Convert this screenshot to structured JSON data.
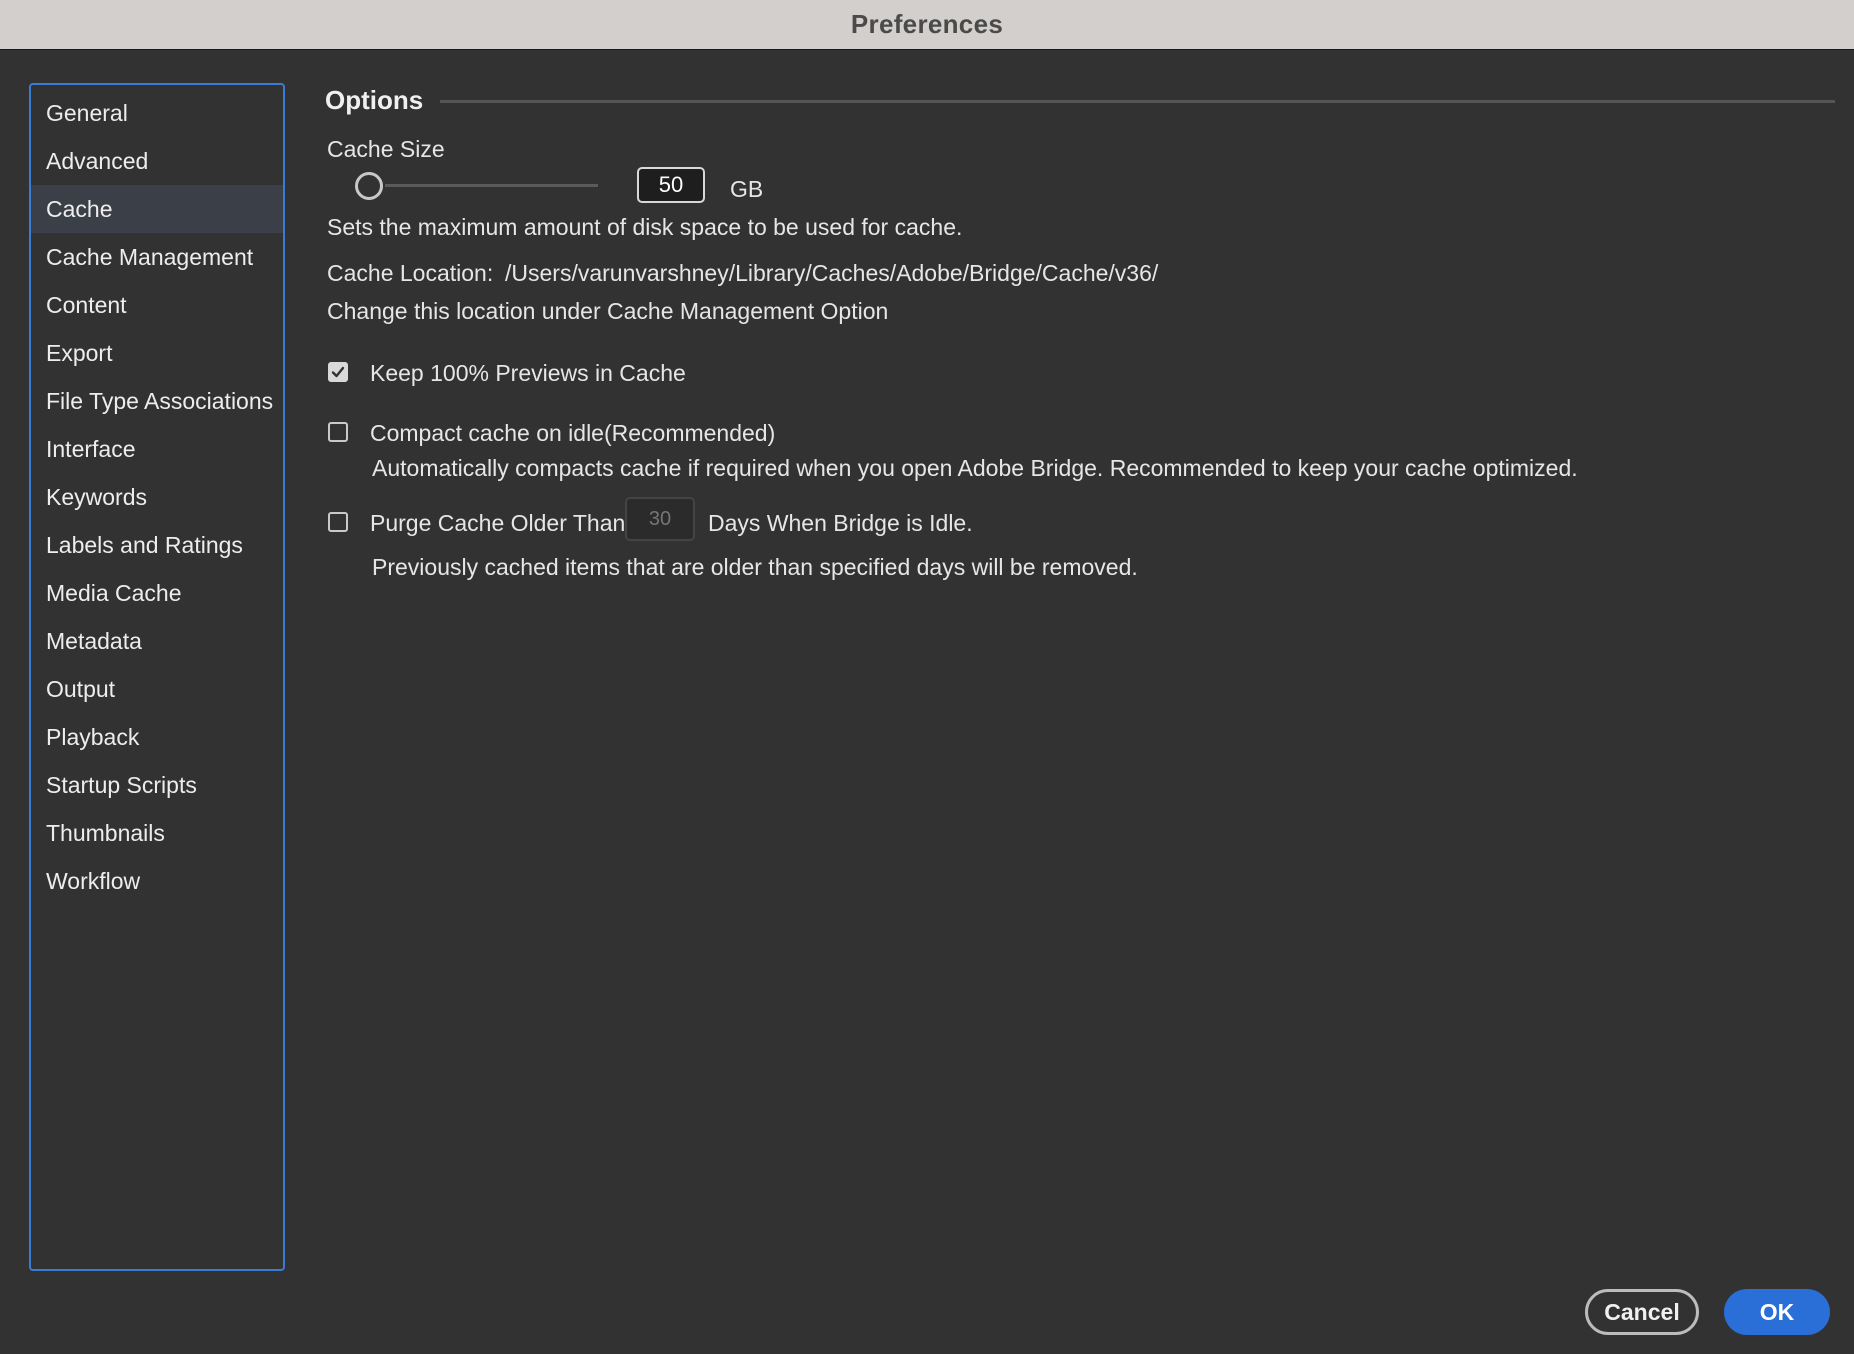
{
  "window": {
    "title": "Preferences"
  },
  "sidebar": {
    "items": [
      {
        "label": "General"
      },
      {
        "label": "Advanced"
      },
      {
        "label": "Cache",
        "selected": true
      },
      {
        "label": "Cache Management"
      },
      {
        "label": "Content"
      },
      {
        "label": "Export"
      },
      {
        "label": "File Type Associations"
      },
      {
        "label": "Interface"
      },
      {
        "label": "Keywords"
      },
      {
        "label": "Labels and Ratings"
      },
      {
        "label": "Media Cache"
      },
      {
        "label": "Metadata"
      },
      {
        "label": "Output"
      },
      {
        "label": "Playback"
      },
      {
        "label": "Startup Scripts"
      },
      {
        "label": "Thumbnails"
      },
      {
        "label": "Workflow"
      }
    ]
  },
  "options": {
    "section_title": "Options",
    "cache_size": {
      "label": "Cache Size",
      "value": "50",
      "unit": "GB",
      "slider_level": 0.0,
      "description": "Sets the maximum amount of disk space to be used for cache."
    },
    "cache_location": {
      "label": "Cache Location:",
      "path": "/Users/varunvarshney/Library/Caches/Adobe/Bridge/Cache/v36/",
      "note": "Change this location under Cache Management Option"
    },
    "keep_previews": {
      "label": "Keep 100% Previews in Cache",
      "checked": true
    },
    "compact_cache": {
      "label": "Compact cache on idle(Recommended)",
      "checked": false,
      "description": "Automatically compacts cache if required when you open Adobe Bridge. Recommended to keep your cache optimized."
    },
    "purge_cache": {
      "label_before": "Purge Cache Older Than",
      "days_placeholder": "30",
      "label_after": "Days When Bridge is Idle.",
      "checked": false,
      "description": "Previously cached items that are older than specified days will be removed."
    }
  },
  "buttons": {
    "cancel": "Cancel",
    "ok": "OK"
  },
  "colors": {
    "background": "#323232",
    "titlebar": "#d3cfcc",
    "sidebar_border": "#3a7bd5",
    "sidebar_selected": "#3b4048",
    "primary_button": "#2a6ed8"
  }
}
